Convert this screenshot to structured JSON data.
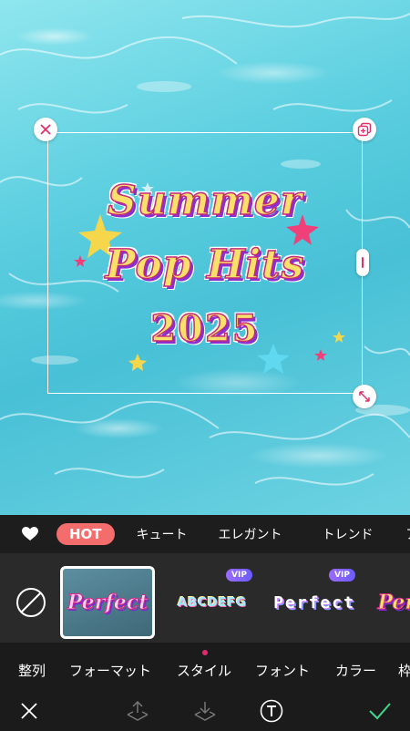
{
  "sticker": {
    "line1": "Summer",
    "line2": "Pop Hits",
    "line3": "2025"
  },
  "categories": {
    "hot": "HOT",
    "items": [
      "キュート",
      "エレガント",
      "トレンド",
      "ア"
    ]
  },
  "presets": [
    {
      "label": "Perfect",
      "selected": true
    },
    {
      "label": "ABCDEFG",
      "vip": "VIP"
    },
    {
      "label": "Perfect",
      "vip": "VIP"
    },
    {
      "label": "Perf"
    }
  ],
  "tabs": [
    "整列",
    "フォーマット",
    "スタイル",
    "フォント",
    "カラー",
    "枠"
  ],
  "active_tab": "スタイル",
  "colors": {
    "accent": "#e02c6e",
    "hot": "#f36d6d",
    "confirm": "#3ed88a",
    "vip": "#8a63ff"
  }
}
